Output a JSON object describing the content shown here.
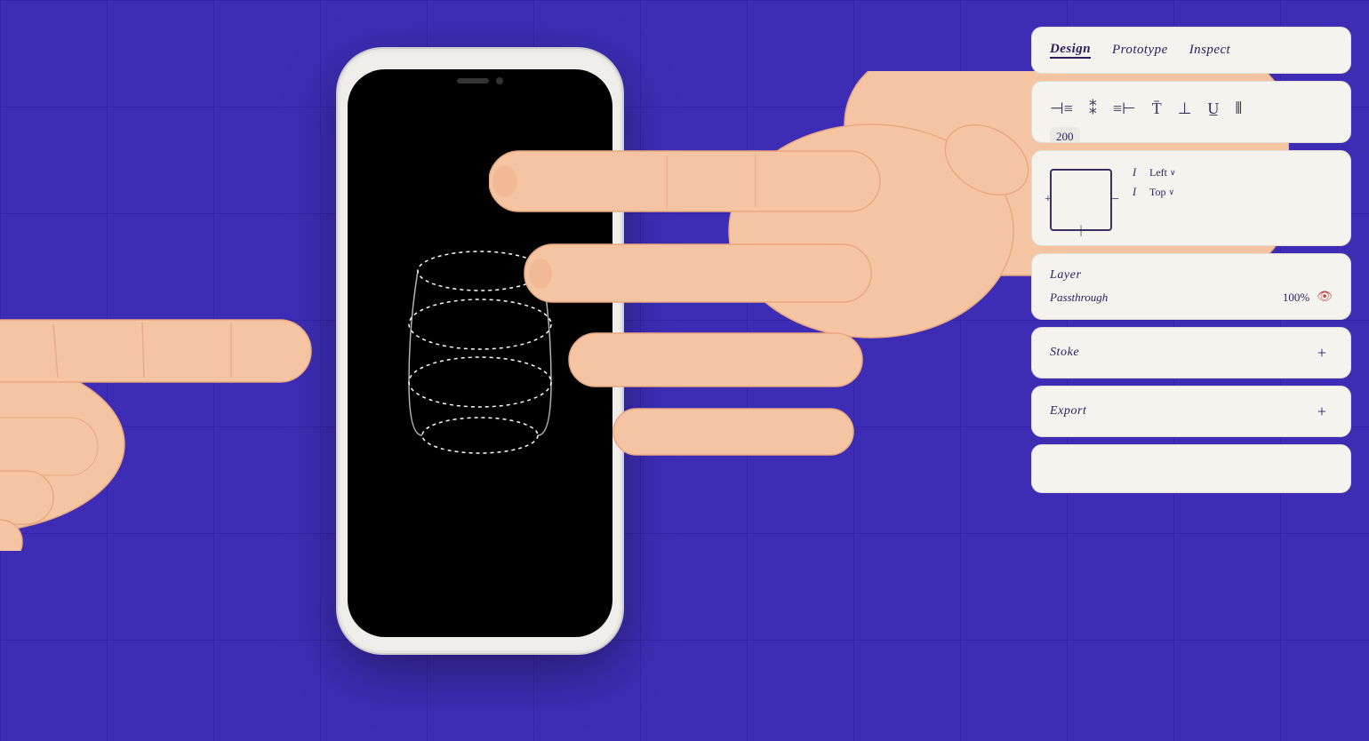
{
  "background": {
    "color": "#3d2db5",
    "grid_color": "rgba(50,30,160,0.6)"
  },
  "tabs": {
    "design_label": "Design",
    "prototype_label": "Prototype",
    "inspect_label": "Inspect"
  },
  "alignment": {
    "icons": [
      "⊣≡",
      "⁑",
      "≡⊢",
      "π̄",
      "⊤",
      "⊥̄",
      "⦀"
    ]
  },
  "position": {
    "left_label": "Left",
    "top_label": "Top",
    "left_value": "",
    "top_value": "",
    "left_dropdown_chevron": "∨",
    "top_dropdown_chevron": "∨",
    "plus_symbol": "+",
    "minus_symbol": "−",
    "bar_symbol": "|"
  },
  "layer": {
    "title": "Layer",
    "blend_mode": "Passthrough",
    "opacity": "100%",
    "has_eye_icon": true
  },
  "stoke": {
    "label": "Stoke",
    "plus_label": "+"
  },
  "export": {
    "label": "Export",
    "plus_label": "+"
  },
  "phone": {
    "has_notch": true
  }
}
